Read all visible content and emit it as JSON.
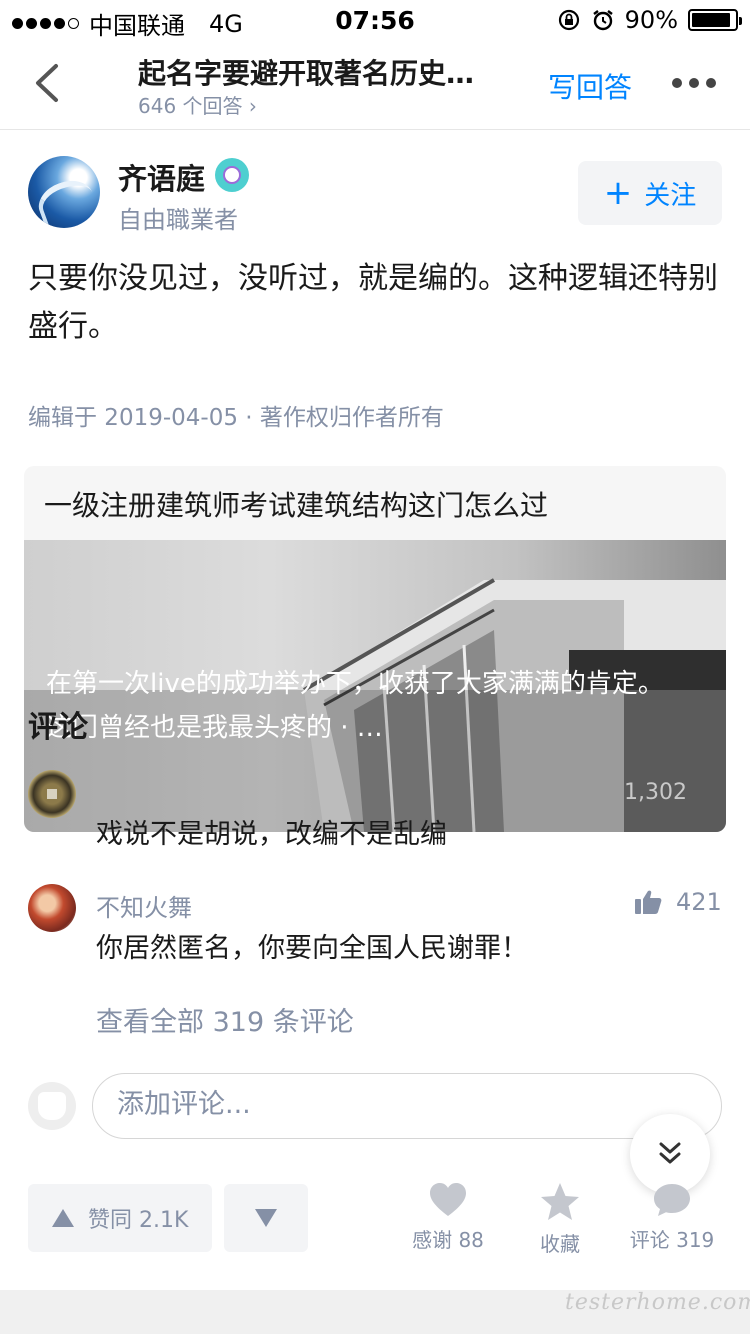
{
  "status_bar": {
    "carrier": "中国联通",
    "network": "4G",
    "time": "07:56",
    "battery": "90%",
    "battery_level": 0.9
  },
  "nav": {
    "title": "起名字要避开取著名历史…",
    "subtitle": "646 个回答 ›",
    "write_answer": "写回答"
  },
  "author": {
    "name": "齐语庭",
    "bio": "自由職業者",
    "follow_label": "关注"
  },
  "answer": {
    "text": "只要你没见过，没听过，就是编的。这种逻辑还特别盛行。",
    "meta": "编辑于 2019-04-05 · 著作权归作者所有"
  },
  "live_card": {
    "title": "一级注册建筑师考试建筑结构这门怎么过",
    "description": "在第一次live的成功举办下，收获了大家满满的肯定。这门曾经也是我最头疼的 · …"
  },
  "comments": {
    "heading": "评论",
    "items": [
      {
        "likes": "1,302",
        "text": "戏说不是胡说，改编不是乱编"
      },
      {
        "author": "不知火舞",
        "likes": "421",
        "text": "你居然匿名，你要向全国人民谢罪！"
      }
    ],
    "view_all": "查看全部 319 条评论",
    "input_placeholder": "添加评论..."
  },
  "bottom_bar": {
    "upvote_label": "赞同 2.1K",
    "thanks_label": "感谢 88",
    "collect_label": "收藏",
    "comment_label": "评论 319"
  },
  "watermark": "testerhome.com",
  "colors": {
    "accent": "#0084ff",
    "muted": "#8590a6",
    "icon": "#c4c7ce"
  }
}
